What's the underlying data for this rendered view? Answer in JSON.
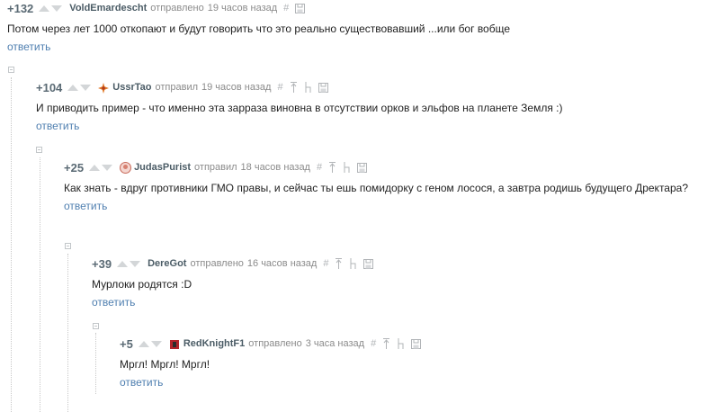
{
  "reply_label": "ответить",
  "comments": [
    {
      "rating": "+132",
      "author": "VoldEmardescht",
      "action": "отправлено",
      "time": "19 часов назад",
      "text": "Потом через лет 1000 откопают и будут говорить что это реально существовавший ...или бог вобще"
    },
    {
      "rating": "+104",
      "author": "UssrTao",
      "action": "отправил",
      "time": "19 часов назад",
      "text": "И приводить пример - что именно эта зарраза виновна в отсутствии орков и эльфов на планете Земля :)"
    },
    {
      "rating": "+25",
      "author": "JudasPurist",
      "action": "отправил",
      "time": "18 часов назад",
      "text": "Как знать - вдруг противники ГМО правы, и сейчас ты ешь помидорку с геном лосося, а завтра родишь будущего Дректара?"
    },
    {
      "rating": "+39",
      "author": "DereGot",
      "action": "отправлено",
      "time": "16 часов назад",
      "text": "Мурлоки родятся :D"
    },
    {
      "rating": "+5",
      "author": "RedKnightF1",
      "action": "отправлено",
      "time": "3 часа назад",
      "text": "Мргл! Мргл! Мргл!"
    }
  ],
  "icons": {
    "link": "#",
    "save": "save-icon",
    "parent": "parent-comment-icon",
    "branch": "branch-icon"
  },
  "colors": {
    "reply_link": "#4f7fb0",
    "author": "#4b5c66",
    "rating": "#5a6a74",
    "meta": "#8b8b8b"
  }
}
